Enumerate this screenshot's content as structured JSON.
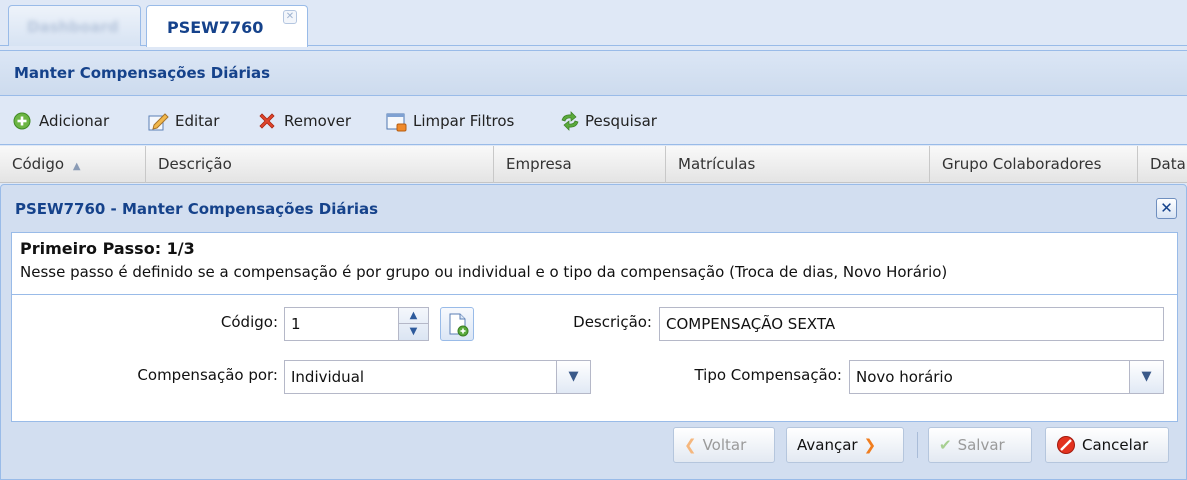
{
  "tabs": [
    {
      "label": "Dashboard"
    },
    {
      "label": "PSEW7760"
    }
  ],
  "panel": {
    "title": "Manter Compensações Diárias"
  },
  "toolbar": {
    "add": "Adicionar",
    "edit": "Editar",
    "remove": "Remover",
    "clear": "Limpar Filtros",
    "search": "Pesquisar"
  },
  "grid": {
    "columns": [
      "Código",
      "Descrição",
      "Empresa",
      "Matrículas",
      "Grupo Colaboradores",
      "Data"
    ]
  },
  "dialog": {
    "title": "PSEW7760 - Manter Compensações Diárias",
    "step_title": "Primeiro Passo: 1/3",
    "step_desc": "Nesse passo é definido se a compensação é por grupo ou individual e o tipo da compensação (Troca de dias, Novo Horário)",
    "form": {
      "codigo_label": "Código:",
      "codigo_value": "1",
      "descricao_label": "Descrição:",
      "descricao_value": "COMPENSAÇÃO SEXTA",
      "comp_por_label": "Compensação por:",
      "comp_por_value": "Individual",
      "tipo_label": "Tipo Compensação:",
      "tipo_value": "Novo horário"
    },
    "buttons": {
      "back": "Voltar",
      "next": "Avançar",
      "save": "Salvar",
      "cancel": "Cancelar"
    }
  },
  "colors": {
    "header_text": "#15428b",
    "border": "#99bbe8",
    "accent_orange": "#f07d1e",
    "add_green": "#5aaa3c",
    "remove_red": "#d9341c",
    "cancel_red": "#d8241c"
  }
}
